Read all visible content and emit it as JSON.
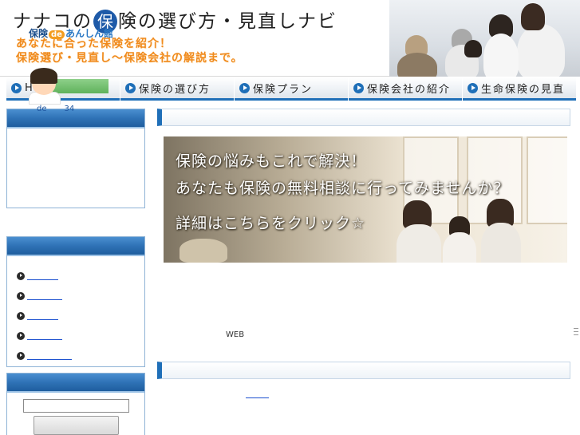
{
  "header": {
    "title_before": "ナナコの",
    "title_highlight": "保",
    "title_after": "険の選び方・見直しナビ",
    "tagline_1": "あなたに合った保険を紹介！",
    "tagline_2": "保険選び・見直し〜保険会社の解説まで。"
  },
  "nav": {
    "items": [
      {
        "label": "HOME"
      },
      {
        "label": "保険の選び方"
      },
      {
        "label": "保険プラン"
      },
      {
        "label": "保険会社の紹介"
      },
      {
        "label": "生命保険の見直"
      }
    ]
  },
  "sidebar": {
    "logo": {
      "part1": "保険",
      "part2": "de",
      "part3": "あんしん館"
    },
    "mascot_caption": {
      "a": "de",
      "b": "34"
    },
    "links": [
      "",
      "",
      "",
      "",
      ""
    ]
  },
  "search": {
    "placeholder": "",
    "button_label": ""
  },
  "banner": {
    "line1": "保険の悩みもこれで解決！",
    "line2": "あなたも保険の無料相談に行ってみませんか？",
    "line3": "詳細はこちらをクリック☆"
  },
  "main": {
    "web_label": "WEB"
  },
  "colors": {
    "accent_blue": "#1f6fb8",
    "tagline_orange": "#f08a1c",
    "link_blue": "#1a4fcf"
  }
}
